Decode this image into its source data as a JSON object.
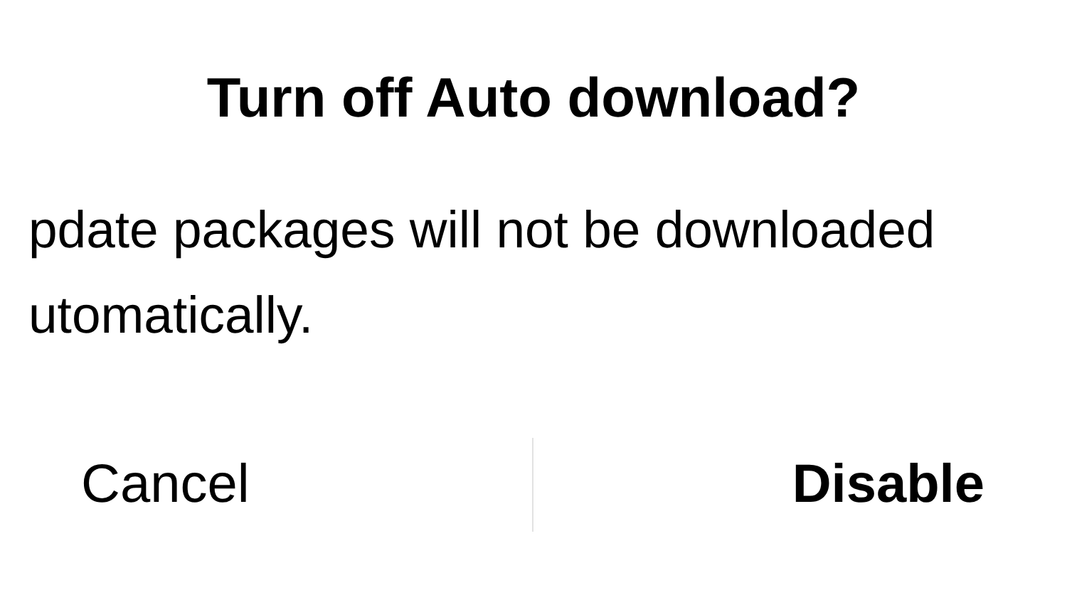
{
  "dialog": {
    "title": "Turn off Auto download?",
    "message": [
      "pdate packages will not be downloaded",
      "utomatically."
    ],
    "buttons": [
      {
        "label": "Cancel",
        "primary": false
      },
      {
        "label": "Disable",
        "primary": true
      }
    ]
  }
}
